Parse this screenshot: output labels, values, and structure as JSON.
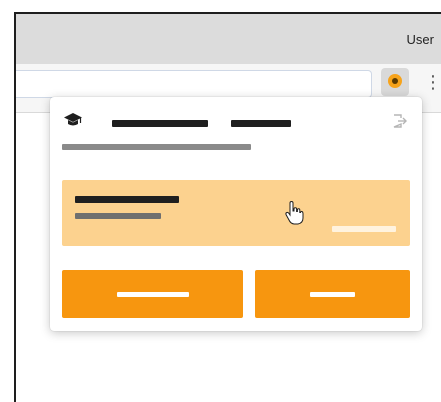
{
  "header": {
    "user_label": "User"
  },
  "toolbar": {
    "address_value": "",
    "extension_icon": "extension-target-icon",
    "menu_icon": "kebab-menu-icon",
    "menu_glyph": "⋮"
  },
  "popup": {
    "header_icon": "graduation-cap-icon",
    "logout_icon": "logout-icon",
    "title": "",
    "subtitle": "",
    "card": {
      "title": "",
      "subtitle": "",
      "action": ""
    },
    "buttons": {
      "primary_label": "",
      "secondary_label": ""
    }
  },
  "colors": {
    "accent": "#f7960f",
    "highlight": "#fcd28f",
    "extension_dot": "#f7a31a"
  }
}
